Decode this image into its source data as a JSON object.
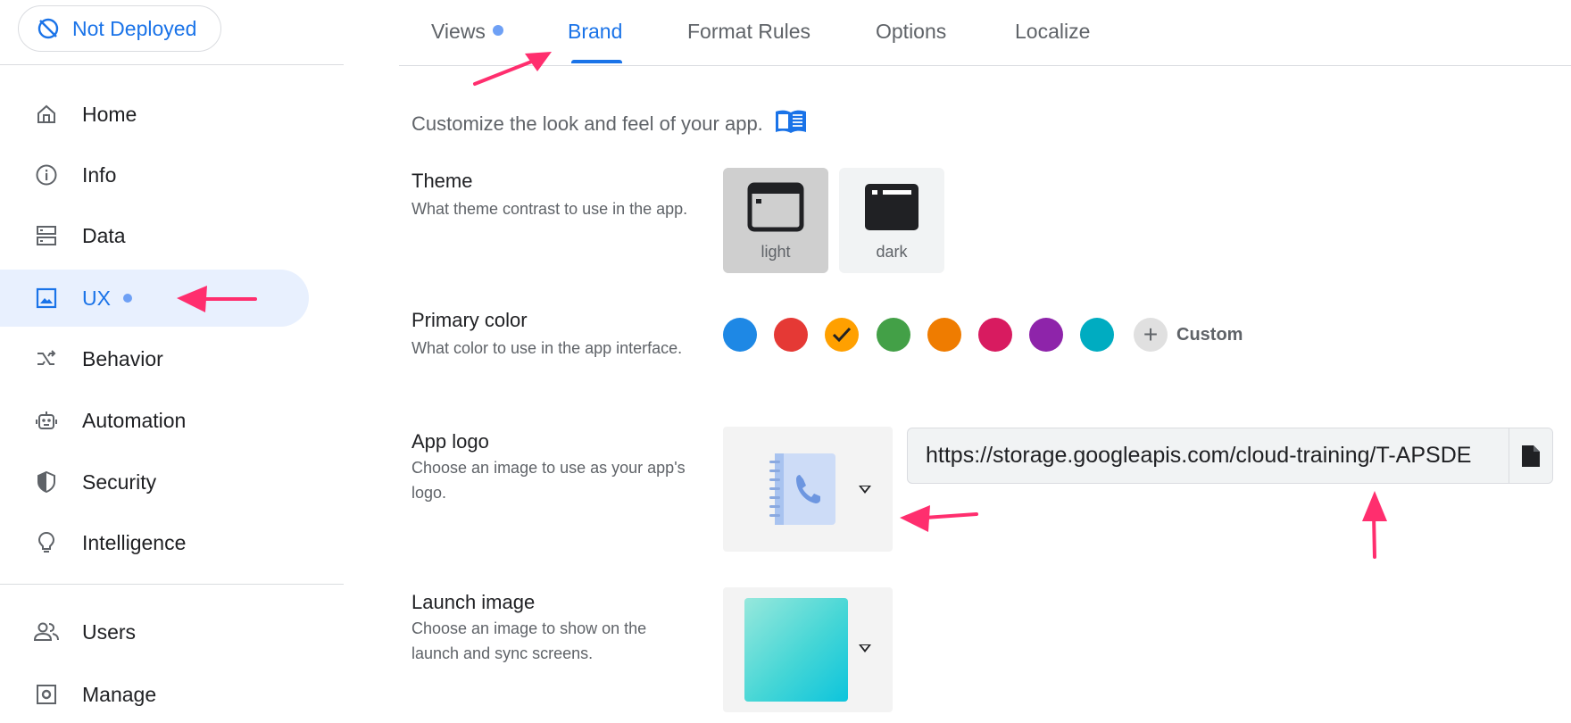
{
  "deploy_status": {
    "label": "Not Deployed"
  },
  "sidebar": {
    "items": [
      {
        "label": "Home",
        "icon": "home-icon"
      },
      {
        "label": "Info",
        "icon": "info-icon"
      },
      {
        "label": "Data",
        "icon": "data-icon"
      },
      {
        "label": "UX",
        "icon": "image-icon",
        "active": true
      },
      {
        "label": "Behavior",
        "icon": "behavior-icon"
      },
      {
        "label": "Automation",
        "icon": "robot-icon"
      },
      {
        "label": "Security",
        "icon": "shield-icon"
      },
      {
        "label": "Intelligence",
        "icon": "lightbulb-icon"
      },
      {
        "label": "Users",
        "icon": "users-icon"
      },
      {
        "label": "Manage",
        "icon": "manage-icon"
      }
    ]
  },
  "tabs": [
    {
      "label": "Views"
    },
    {
      "label": "Brand",
      "active": true
    },
    {
      "label": "Format Rules"
    },
    {
      "label": "Options"
    },
    {
      "label": "Localize"
    }
  ],
  "brand": {
    "intro": "Customize the look and feel of your app.",
    "theme": {
      "label": "Theme",
      "desc": "What theme contrast to use in the app.",
      "options": [
        {
          "label": "light",
          "selected": true
        },
        {
          "label": "dark"
        }
      ]
    },
    "primary_color": {
      "label": "Primary color",
      "desc": "What color to use in the app interface.",
      "swatches": [
        "#1e88e5",
        "#e53935",
        "#ffa000",
        "#43a047",
        "#ef7c00",
        "#d81b60",
        "#8e24aa",
        "#00acc1"
      ],
      "selected_index": 2,
      "custom_label": "Custom"
    },
    "app_logo": {
      "label": "App logo",
      "desc": "Choose an image to use as your app's logo.",
      "url": "https://storage.googleapis.com/cloud-training/T-APSDE"
    },
    "launch_image": {
      "label": "Launch image",
      "desc": "Choose an image to show on the launch and sync screens."
    }
  }
}
